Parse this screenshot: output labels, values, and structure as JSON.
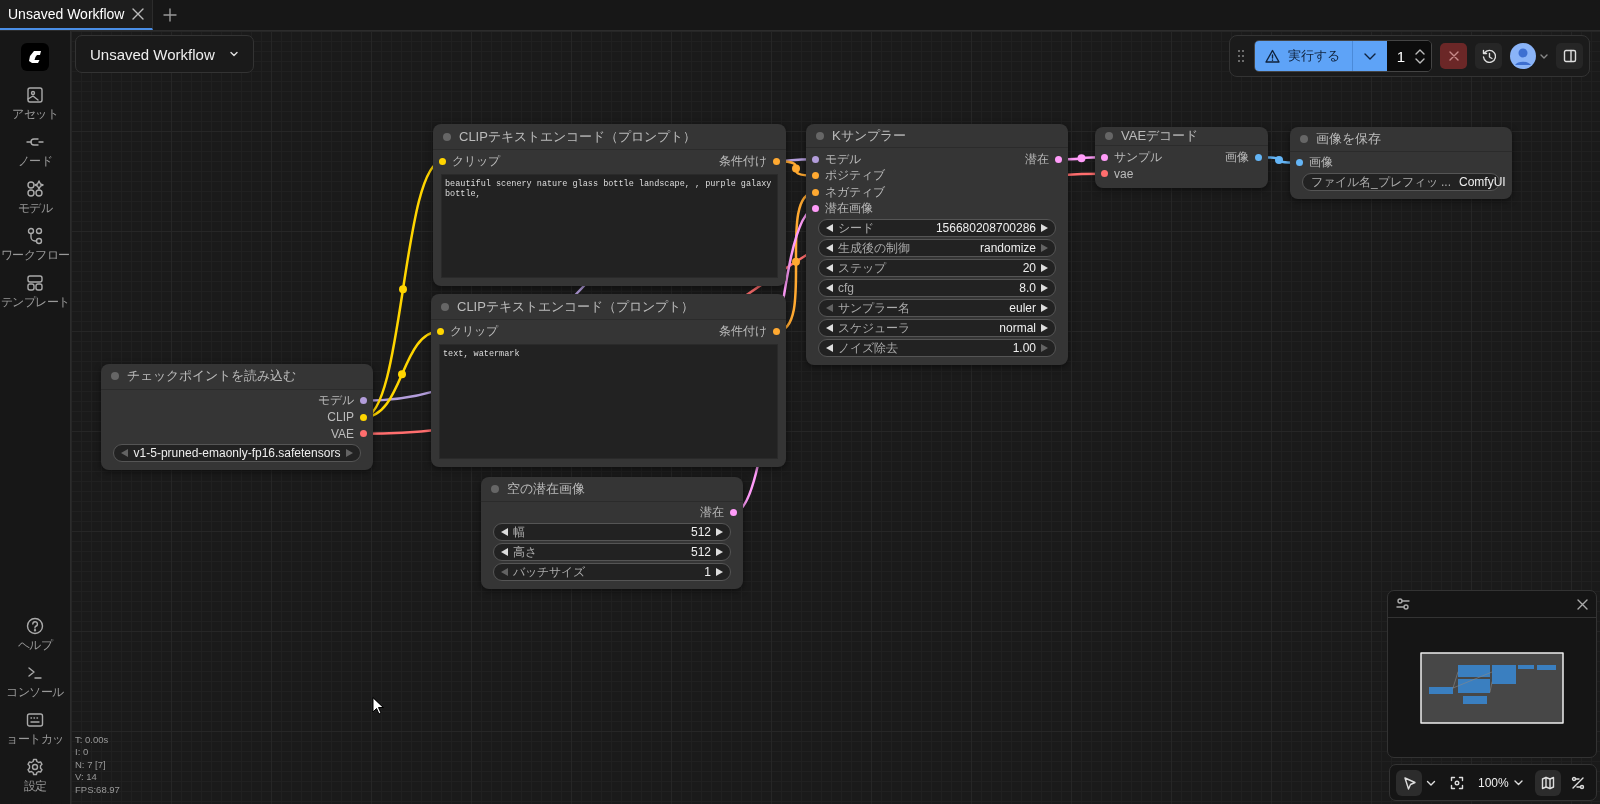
{
  "tab_bar": {
    "tabs": [
      {
        "label": "Unsaved Workflow",
        "selected": true
      }
    ]
  },
  "sidebar": {
    "top_items": [
      {
        "kind": "logo"
      },
      {
        "kind": "assets",
        "label": "アセット"
      },
      {
        "kind": "nodes",
        "label": "ノード"
      },
      {
        "kind": "models",
        "label": "モデル"
      },
      {
        "kind": "workflows",
        "label": "ワークフロー"
      },
      {
        "kind": "templates",
        "label": "テンプレート"
      }
    ],
    "bottom_items": [
      {
        "kind": "help",
        "label": "ヘルプ"
      },
      {
        "kind": "console",
        "label": "コンソール"
      },
      {
        "kind": "shortcuts",
        "label": "ョートカッ"
      },
      {
        "kind": "settings",
        "label": "設定"
      }
    ]
  },
  "workflow_menu": {
    "title": "Unsaved Workflow"
  },
  "toolbar": {
    "run_label": "実行する",
    "batch_count": "1"
  },
  "nodes": [
    {
      "title": "CLIPテキストエンコード（プロンプト）",
      "inputs": [
        {
          "label": "クリップ",
          "color": "#ffd500"
        }
      ],
      "outputs": [
        {
          "label": "条件付け",
          "color": "#ffa931"
        }
      ],
      "prompt": "beautiful scenery nature glass bottle landscape, , purple galaxy bottle,"
    },
    {
      "title": "Kサンプラー",
      "inputs": [
        {
          "label": "モデル",
          "color": "#b39ddb"
        },
        {
          "label": "ポジティブ",
          "color": "#ffa931"
        },
        {
          "label": "ネガティブ",
          "color": "#ffa931"
        },
        {
          "label": "潜在画像",
          "color": "#ff9cf9"
        }
      ],
      "outputs": [
        {
          "label": "潜在",
          "color": "#ff9cf9"
        }
      ],
      "widgets": [
        {
          "kind": "number",
          "label": "シード",
          "value": "156680208700286",
          "prev_enabled": true,
          "next_enabled": true
        },
        {
          "kind": "combo",
          "label": "生成後の制御",
          "value": "randomize",
          "prev_enabled": true,
          "next_enabled": false
        },
        {
          "kind": "number",
          "label": "ステップ",
          "value": "20",
          "prev_enabled": true,
          "next_enabled": true
        },
        {
          "kind": "number",
          "label": "cfg",
          "value": "8.0",
          "prev_enabled": true,
          "next_enabled": true
        },
        {
          "kind": "combo",
          "label": "サンプラー名",
          "value": "euler",
          "prev_enabled": false,
          "next_enabled": true
        },
        {
          "kind": "combo",
          "label": "スケジューラ",
          "value": "normal",
          "prev_enabled": true,
          "next_enabled": true
        },
        {
          "kind": "number",
          "label": "ノイズ除去",
          "value": "1.00",
          "prev_enabled": true,
          "next_enabled": false
        }
      ]
    },
    {
      "title": "VAEデコード",
      "inputs": [
        {
          "label": "サンプル",
          "color": "#ff9cf9"
        },
        {
          "label": "vae",
          "color": "#ff6e6e"
        }
      ],
      "outputs": [
        {
          "label": "画像",
          "color": "#64b5f6"
        }
      ]
    },
    {
      "title": "画像を保存",
      "inputs": [
        {
          "label": "画像",
          "color": "#64b5f6"
        }
      ],
      "widgets": [
        {
          "kind": "text",
          "label": "ファイル名_プレフィッ ...",
          "value": "ComfyUI"
        }
      ]
    },
    {
      "title": "CLIPテキストエンコード（プロンプト）",
      "inputs": [
        {
          "label": "クリップ",
          "color": "#ffd500"
        }
      ],
      "outputs": [
        {
          "label": "条件付け",
          "color": "#ffa931"
        }
      ],
      "prompt": "text, watermark"
    },
    {
      "title": "チェックポイントを読み込む",
      "outputs": [
        {
          "label": "モデル",
          "color": "#b39ddb"
        },
        {
          "label": "CLIP",
          "color": "#ffd500"
        },
        {
          "label": "VAE",
          "color": "#ff6e6e"
        }
      ],
      "widgets": [
        {
          "kind": "combo",
          "value": "v1-5-pruned-emaonly-fp16.safetensors",
          "prev_enabled": false,
          "next_enabled": false
        }
      ]
    },
    {
      "title": "空の潜在画像",
      "outputs": [
        {
          "label": "潜在",
          "color": "#ff9cf9"
        }
      ],
      "widgets": [
        {
          "kind": "number",
          "label": "幅",
          "value": "512",
          "prev_enabled": true,
          "next_enabled": true
        },
        {
          "kind": "number",
          "label": "高さ",
          "value": "512",
          "prev_enabled": true,
          "next_enabled": true
        },
        {
          "kind": "number",
          "label": "バッチサイズ",
          "value": "1",
          "prev_enabled": false,
          "next_enabled": true
        }
      ]
    }
  ],
  "stats": [
    "T: 0.00s",
    "I: 0",
    "N: 7 [7]",
    "V: 14",
    "FPS:68.97"
  ],
  "canvas_toolbar": {
    "zoom": "100%",
    "tools": [
      {
        "kind": "pointer",
        "selected": true
      },
      {
        "kind": "fit",
        "selected": false
      },
      {
        "kind": "minimap",
        "selected": true
      },
      {
        "kind": "links",
        "selected": false
      }
    ]
  }
}
